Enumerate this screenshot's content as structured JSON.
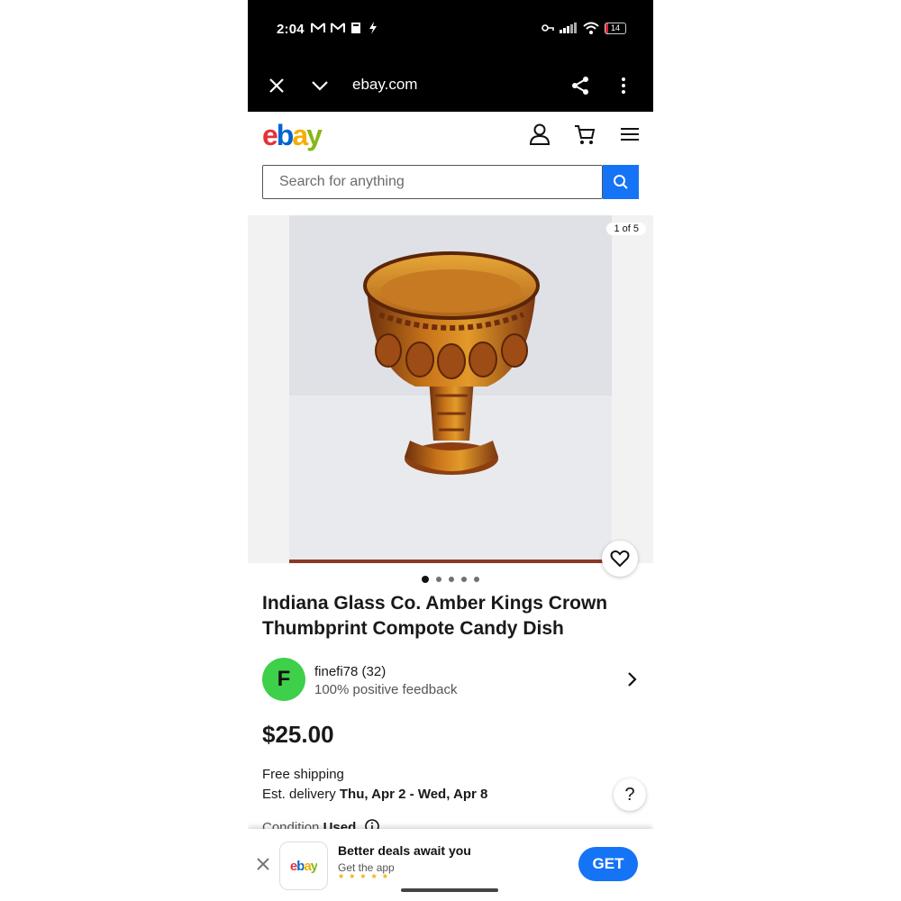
{
  "status_bar": {
    "time": "2:04",
    "battery": "14"
  },
  "browser": {
    "url": "ebay.com"
  },
  "header": {
    "logo_letters": [
      "e",
      "b",
      "a",
      "y"
    ],
    "logo_colors": [
      "#e53238",
      "#0064d2",
      "#f5af02",
      "#86b817"
    ]
  },
  "search": {
    "placeholder": "Search for anything"
  },
  "gallery": {
    "counter": "1 of 5",
    "dots_total": 5,
    "active_dot": 1
  },
  "listing": {
    "title": "Indiana Glass Co. Amber Kings Crown Thumbprint Compote Candy Dish",
    "price": "$25.00",
    "shipping": "Free shipping",
    "delivery_label": "Est. delivery",
    "delivery_dates": "Thu, Apr 2 - Wed, Apr 8",
    "condition_label": "Condition",
    "condition_value": "Used"
  },
  "seller": {
    "initial": "F",
    "name": "finefi78 (32)",
    "feedback": "100% positive feedback"
  },
  "app_banner": {
    "logo_text": "ebay",
    "title": "Better deals await you",
    "subtitle": "Get the app",
    "stars": "★★★★★",
    "button": "GET"
  },
  "colors": {
    "accent_blue": "#1573f6",
    "avatar_green": "#3ecf4b"
  }
}
